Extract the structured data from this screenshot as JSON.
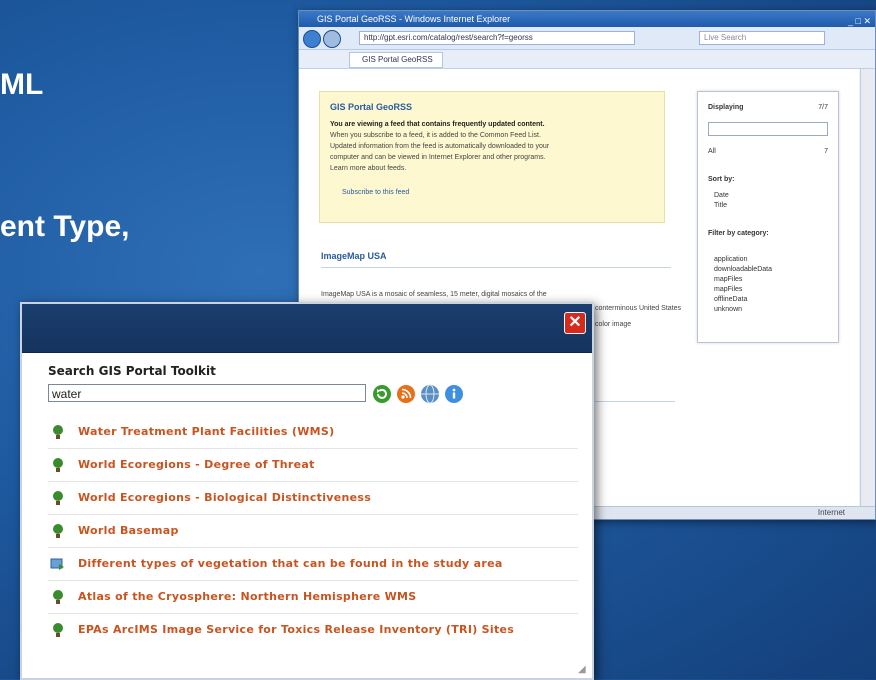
{
  "slide": {
    "line1": "ML",
    "line2": "ent Type,"
  },
  "browser": {
    "title": "GIS Portal GeoRSS - Windows Internet Explorer",
    "address": "http://gpt.esri.com/catalog/rest/search?f=georss",
    "search_placeholder": "Live Search",
    "tab_label": "GIS Portal GeoRSS",
    "status": "Internet",
    "feed": {
      "title": "GIS Portal GeoRSS",
      "bold_line": "You are viewing a feed that contains frequently updated content.",
      "lines": [
        "When you subscribe to a feed, it is added to the Common Feed List.",
        "Updated information from the feed is automatically downloaded to your",
        "computer and can be viewed in Internet Explorer and other programs.",
        "Learn more about feeds."
      ],
      "subscribe": "Subscribe to this feed"
    },
    "entry": {
      "title": "ImageMap USA",
      "text1": "ImageMap USA is a mosaic of seamless, 15 meter, digital mosaics of the",
      "text2": "conterminous United States",
      "text3": "color image"
    },
    "panel": {
      "header": "Displaying",
      "count": "7/7",
      "all": "All",
      "all_count": "7",
      "sort_by": "Sort by:",
      "sort_options": [
        "Date",
        "Title"
      ],
      "filter_by": "Filter by category:",
      "categories": [
        "application",
        "downloadableData",
        "mapFiles",
        "mapFiles",
        "offlineData",
        "unknown"
      ]
    }
  },
  "toolkit": {
    "title": "Search GIS Portal Toolkit",
    "search_value": "water",
    "results": [
      {
        "label": "Water Treatment Plant Facilities (WMS)",
        "icon": "globe-person-icon"
      },
      {
        "label": "World Ecoregions - Degree of Threat",
        "icon": "globe-person-icon"
      },
      {
        "label": "World Ecoregions - Biological Distinctiveness",
        "icon": "globe-person-icon"
      },
      {
        "label": "World Basemap",
        "icon": "globe-person-icon"
      },
      {
        "label": "Different types of vegetation that can be found in the study area",
        "icon": "map-document-icon"
      },
      {
        "label": "Atlas of the Cryosphere: Northern Hemisphere WMS",
        "icon": "globe-person-icon"
      },
      {
        "label": "EPAs ArcIMS Image Service for Toxics Release Inventory (TRI) Sites",
        "icon": "globe-person-icon"
      }
    ]
  }
}
